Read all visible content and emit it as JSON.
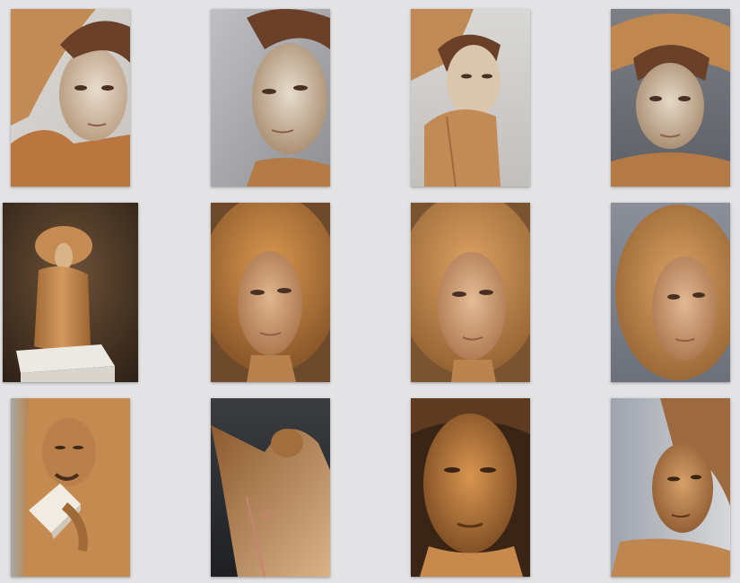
{
  "gallery": {
    "background": "#e3e3e5",
    "wood_color": "#c8894a",
    "items": [
      {
        "subject": "carved-face-closeup"
      },
      {
        "subject": "carved-face-three-quarter"
      },
      {
        "subject": "carved-figure-side"
      },
      {
        "subject": "carved-face-hat-front"
      },
      {
        "subject": "carved-bust-on-pedestal"
      },
      {
        "subject": "carved-face-curly-hair"
      },
      {
        "subject": "carved-face-curly-hair-closer"
      },
      {
        "subject": "carved-face-curly-hair-side"
      },
      {
        "subject": "carved-figure-holding-object"
      },
      {
        "subject": "carved-figure-from-below"
      },
      {
        "subject": "carved-face-strong-light"
      },
      {
        "subject": "carved-face-profile"
      }
    ]
  }
}
